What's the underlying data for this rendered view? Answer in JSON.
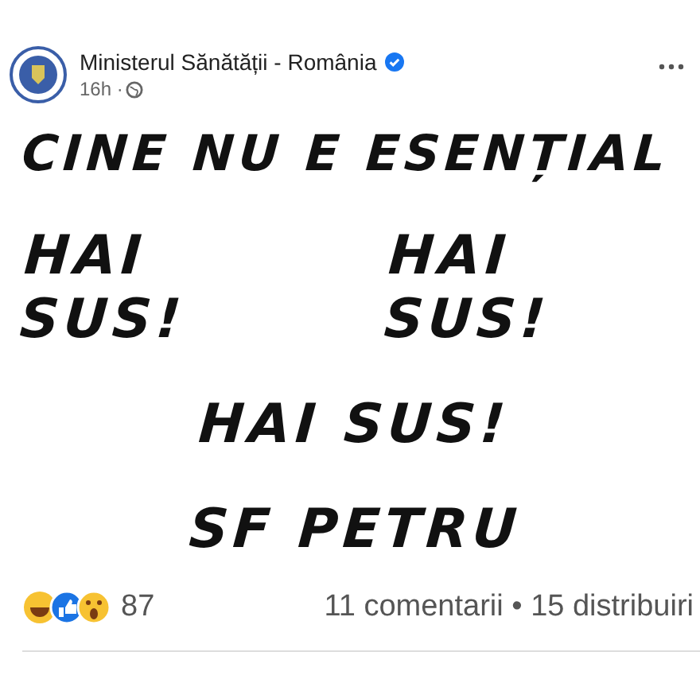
{
  "post": {
    "author": "Ministerul Sănătății - România",
    "verified": true,
    "time": "16h ·"
  },
  "image_lines": [
    [
      "CINE NU E ESENȚIAL"
    ],
    [
      "HAI SUS!",
      "HAI SUS!"
    ],
    [
      "HAI SUS!"
    ],
    [
      "SF PETRU"
    ]
  ],
  "footer": {
    "reaction_count": "87",
    "comments": "11 comentarii",
    "separator": "•",
    "shares": "15 distribuiri"
  }
}
